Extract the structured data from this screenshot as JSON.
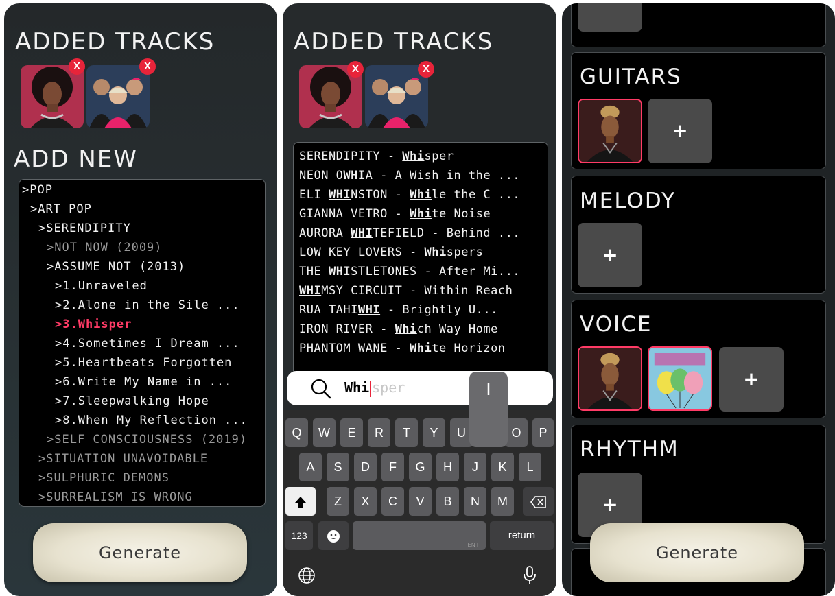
{
  "panel_left": {
    "added_title": "ADDED TRACKS",
    "add_new_title": "ADD NEW",
    "remove_label": "X",
    "tree": [
      {
        "label": ">POP",
        "level": "normal"
      },
      {
        "label": ">ART POP",
        "level": "normal"
      },
      {
        "label": ">SERENDIPITY",
        "level": "normal"
      },
      {
        "label": ">NOT NOW (2009)",
        "level": "dim"
      },
      {
        "label": ">ASSUME NOT (2013)",
        "level": "normal"
      },
      {
        "label": ">1.Unraveled",
        "level": "normal"
      },
      {
        "label": ">2.Alone in the Sile ...",
        "level": "normal"
      },
      {
        "label": ">3.Whisper",
        "level": "highlight"
      },
      {
        "label": ">4.Sometimes I Dream ...",
        "level": "normal"
      },
      {
        "label": ">5.Heartbeats Forgotten",
        "level": "normal"
      },
      {
        "label": ">6.Write My Name in ...",
        "level": "normal"
      },
      {
        "label": ">7.Sleepwalking Hope",
        "level": "normal"
      },
      {
        "label": ">8.When My Reflection ...",
        "level": "normal"
      },
      {
        "label": ">SELF CONSCIOUSNESS (2019)",
        "level": "dim"
      },
      {
        "label": ">SITUATION UNAVOIDABLE",
        "level": "dim"
      },
      {
        "label": ">SULPHURIC DEMONS",
        "level": "dim"
      },
      {
        "label": ">SURREALISM IS WRONG",
        "level": "dim"
      }
    ],
    "generate_label": "Generate"
  },
  "panel_middle": {
    "added_title": "ADDED TRACKS",
    "remove_label": "X",
    "results": [
      {
        "pre": "SERENDIPITY - ",
        "match": "Whi",
        "post": "sper"
      },
      {
        "pre": "NEON O",
        "match": "WHI",
        "post": "A - A Wish in the ..."
      },
      {
        "pre": "ELI ",
        "match": "WHI",
        "post": "NSTON - ",
        "match2": "Whi",
        "post2": "le the C ..."
      },
      {
        "pre": "GIANNA VETRO - ",
        "match": "Whi",
        "post": "te Noise"
      },
      {
        "pre": "AURORA ",
        "match": "WHI",
        "post": "TEFIELD - Behind ..."
      },
      {
        "pre": "LOW KEY LOVERS - ",
        "match": "Whi",
        "post": "spers"
      },
      {
        "pre": "THE ",
        "match": "WHI",
        "post": "STLETONES - After Mi..."
      },
      {
        "pre": "",
        "match": "WHI",
        "post": "MSY CIRCUIT - Within Reach"
      },
      {
        "pre": "RUA TAHI",
        "match": "WHI",
        "post": " - Brightly U..."
      },
      {
        "pre": "IRON RIVER - ",
        "match": "Whi",
        "post": "ch Way Home"
      },
      {
        "pre": "PHANTOM WANE - ",
        "match": "Whi",
        "post": "te Horizon"
      }
    ],
    "search": {
      "typed": "Whi",
      "suggestion": "sper"
    },
    "key_popup": "I",
    "keyboard": {
      "row1": [
        "Q",
        "W",
        "E",
        "R",
        "T",
        "Y",
        "U",
        "",
        "O",
        "P"
      ],
      "row2": [
        "A",
        "S",
        "D",
        "F",
        "G",
        "H",
        "J",
        "K",
        "L"
      ],
      "row3": [
        "Z",
        "X",
        "C",
        "V",
        "B",
        "N",
        "M"
      ],
      "numbers_label": "123",
      "lang_tag": "EN IT",
      "return_label": "return"
    }
  },
  "panel_right": {
    "add_symbol": "+",
    "sections": [
      {
        "title": "GUITARS"
      },
      {
        "title": "MELODY"
      },
      {
        "title": "VOICE"
      },
      {
        "title": "RHYTHM"
      }
    ],
    "generate_label": "Generate"
  }
}
